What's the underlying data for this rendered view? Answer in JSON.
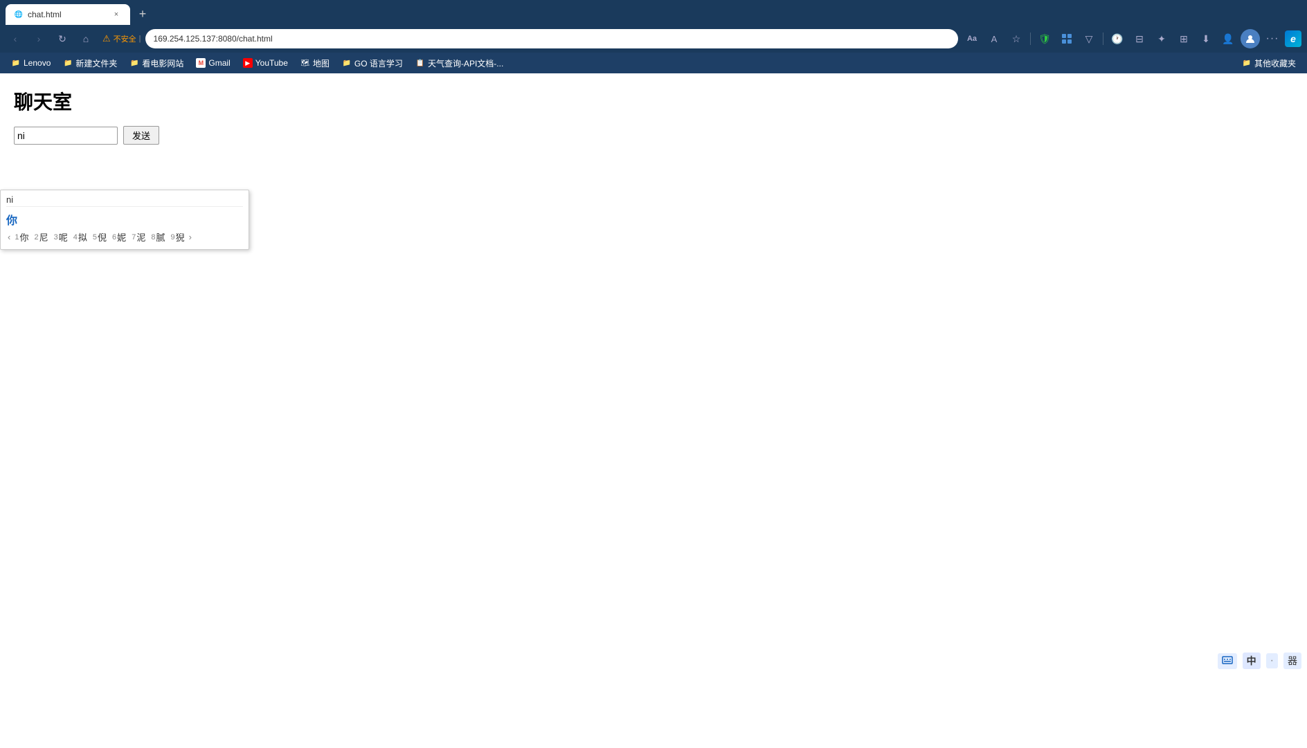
{
  "browser": {
    "tab": {
      "title": "chat.html",
      "favicon": "🌐"
    },
    "address": "169.254.125.137:8080/chat.html",
    "security_label": "不安全",
    "new_tab_label": "+",
    "close_tab_label": "×"
  },
  "nav_buttons": {
    "back": "‹",
    "forward": "›",
    "refresh": "↻",
    "home": "⌂"
  },
  "toolbar": {
    "read_aloud": "Aa",
    "text_size": "A",
    "favorites": "☆",
    "shield": "🛡",
    "extensions": "□",
    "vpn": "▽",
    "history": "🕐",
    "split": "⊟",
    "collections": "☆",
    "browser_essentials": "⊞",
    "download": "⬇",
    "profile_icon": "👤",
    "more": "…",
    "edge_icon": "e"
  },
  "bookmarks": [
    {
      "label": "Lenovo",
      "type": "folder"
    },
    {
      "label": "新建文件夹",
      "type": "folder"
    },
    {
      "label": "看电影网站",
      "type": "folder"
    },
    {
      "label": "Gmail",
      "favicon": "M"
    },
    {
      "label": "YouTube",
      "favicon": "▶"
    },
    {
      "label": "地图",
      "favicon": "🗺"
    },
    {
      "label": "GO 语言学习",
      "type": "folder"
    },
    {
      "label": "天气查询-API文档-...",
      "favicon": "📋"
    },
    {
      "label": "其他收藏夹",
      "type": "folder"
    }
  ],
  "page": {
    "title": "聊天室",
    "input_value": "ni",
    "send_button_label": "发送"
  },
  "ime": {
    "pinyin": "ni",
    "selected": "你",
    "candidates": [
      {
        "num": "1",
        "char": "你"
      },
      {
        "num": "2",
        "char": "尼"
      },
      {
        "num": "3",
        "char": "呢"
      },
      {
        "num": "4",
        "char": "拟"
      },
      {
        "num": "5",
        "char": "倪"
      },
      {
        "num": "6",
        "char": "妮"
      },
      {
        "num": "7",
        "char": "泥"
      },
      {
        "num": "8",
        "char": "腻"
      },
      {
        "num": "9",
        "char": "猊"
      }
    ],
    "nav_prev": "‹",
    "nav_next": "›"
  },
  "system_tray": {
    "ime_label": "中",
    "dot_label": "·",
    "grid_label": "器"
  }
}
